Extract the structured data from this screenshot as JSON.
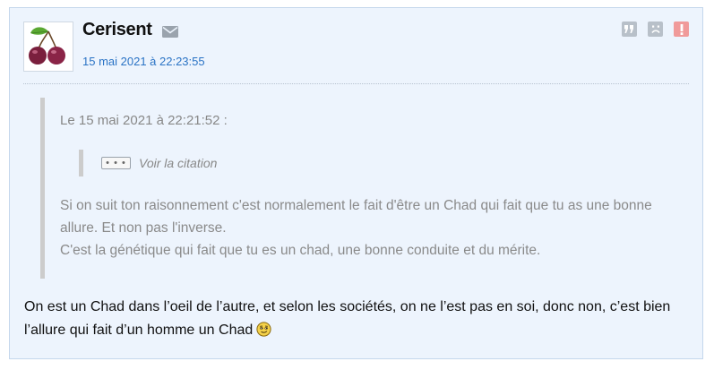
{
  "post": {
    "author": "Cerisent",
    "timestamp": "15 mai 2021 à 22:23:55",
    "avatar_icon": "cherry-icon",
    "actions": [
      {
        "name": "quote-button",
        "icon": "quote-icon"
      },
      {
        "name": "sad-smiley-button",
        "icon": "sad-face-icon"
      },
      {
        "name": "report-button",
        "icon": "exclamation-icon"
      }
    ],
    "quote": {
      "header": "Le 15 mai 2021 à 22:21:52 :",
      "nested": {
        "ellipsis": "• • •",
        "link_label": "Voir la citation"
      },
      "lines": [
        "Si on suit ton raisonnement c'est normalement le fait d'être un Chad qui fait que tu as une bonne allure. Et non pas l'inverse.",
        "C'est la génétique qui fait que tu es un chad, une bonne conduite et du mérite."
      ]
    },
    "reply": "On est un Chad dans l’oeil de l’autre, et selon les sociétés, on ne l’est pas en soi, donc non, c’est bien l’allure qui fait d’un homme un Chad",
    "reply_emoticon": "smirk-smiley-icon"
  },
  "colors": {
    "post_background": "#edf4fd",
    "post_border": "#c5d7ec",
    "link": "#2a73c5",
    "quote_text": "#8a8a8a",
    "report_red": "#f09a9a"
  }
}
